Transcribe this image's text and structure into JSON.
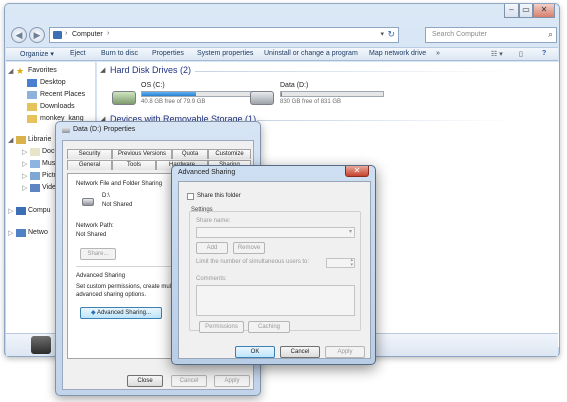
{
  "explorer": {
    "breadcrumb": "Computer",
    "search_placeholder": "Search Computer",
    "toolbar": [
      "Organize ▾",
      "Eject",
      "Burn to disc",
      "Properties",
      "System properties",
      "Uninstall or change a program",
      "Map network drive",
      "»"
    ],
    "nav": {
      "favorites": "Favorites",
      "desktop": "Desktop",
      "recent": "Recent Places",
      "downloads": "Downloads",
      "user": "monkey_kang",
      "libraries": "Librarie",
      "documents": "Docu",
      "music": "Musi",
      "pictures": "Pictu",
      "videos": "Vide",
      "computer": "Compu",
      "network": "Netwo"
    },
    "groups": {
      "hdd": "Hard Disk Drives (2)",
      "removable": "Devices with Removable Storage (1)"
    },
    "drives": [
      {
        "name": "OS (C:)",
        "free": "40.8 GB free of 79.9 GB",
        "used_fraction": 0.49
      },
      {
        "name": "Data (D:)",
        "free": "830 GB free of 831 GB",
        "used_fraction": 0.01
      }
    ]
  },
  "props": {
    "title": "Data (D:) Properties",
    "tabs_row1": [
      "Security",
      "Previous Versions",
      "Quota",
      "Customize"
    ],
    "tabs_row2": [
      "General",
      "Tools",
      "Hardware",
      "Sharing"
    ],
    "section_title": "Network File and Folder Sharing",
    "drive": "D:\\",
    "share_state": "Not Shared",
    "network_path_label": "Network Path:",
    "network_path": "Not Shared",
    "share_button": "Share...",
    "adv_title": "Advanced Sharing",
    "adv_desc_line1": "Set custom permissions, create multiple",
    "adv_desc_line2": "advanced sharing options.",
    "adv_button": "Advanced Sharing...",
    "close": "Close",
    "cancel": "Cancel",
    "apply": "Apply"
  },
  "adv": {
    "title": "Advanced Sharing",
    "share_checkbox": "Share this folder",
    "settings": "Settings",
    "share_name": "Share name:",
    "add": "Add",
    "remove": "Remove",
    "limit": "Limit the number of simultaneous users to:",
    "comments": "Comments:",
    "permissions": "Permissions",
    "caching": "Caching",
    "ok": "OK",
    "cancel": "Cancel",
    "apply": "Apply"
  }
}
